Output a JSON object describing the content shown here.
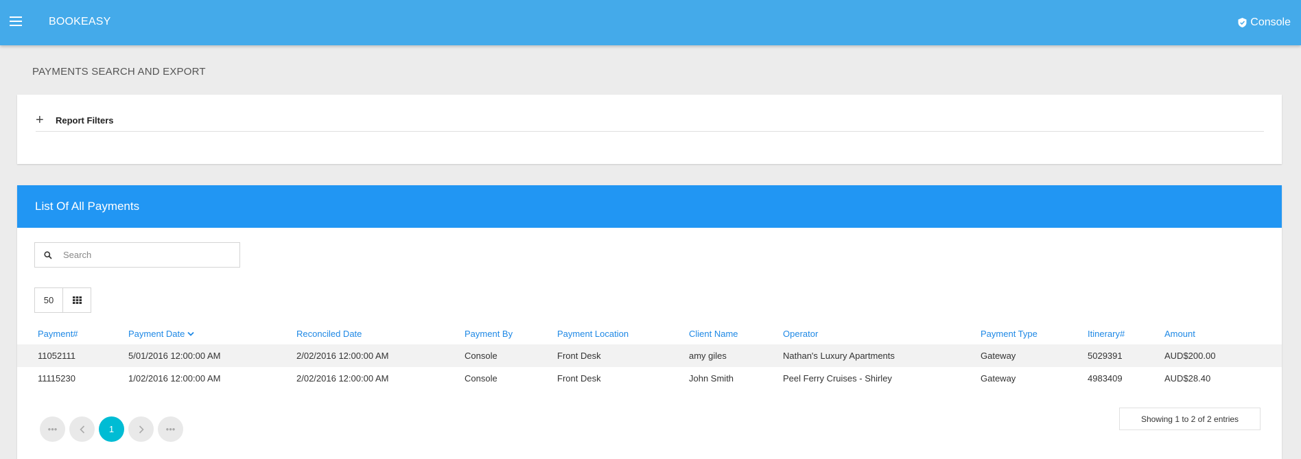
{
  "app": {
    "brand": "BOOKEASY",
    "console_label": "Console"
  },
  "page": {
    "title": "PAYMENTS SEARCH AND EXPORT"
  },
  "filters": {
    "label": "Report Filters"
  },
  "payments": {
    "header": "List Of All Payments",
    "search_placeholder": "Search",
    "page_size": "50",
    "columns": [
      "Payment#",
      "Payment Date",
      "Reconciled Date",
      "Payment By",
      "Payment Location",
      "Client Name",
      "Operator",
      "Payment Type",
      "Itinerary#",
      "Amount"
    ],
    "rows": [
      [
        "11052111",
        "5/01/2016 12:00:00 AM",
        "2/02/2016 12:00:00 AM",
        "Console",
        "Front Desk",
        "amy giles",
        "Nathan's Luxury Apartments",
        "Gateway",
        "5029391",
        "AUD$200.00"
      ],
      [
        "11115230",
        "1/02/2016 12:00:00 AM",
        "2/02/2016 12:00:00 AM",
        "Console",
        "Front Desk",
        "John Smith",
        "Peel Ferry Cruises - Shirley",
        "Gateway",
        "4983409",
        "AUD$28.40"
      ]
    ],
    "pagination": {
      "current_page": "1",
      "info": "Showing 1 to 2 of 2 entries"
    }
  },
  "colors": {
    "topbar": "#44aaea",
    "card_header": "#2196f3",
    "link": "#1e88e5",
    "active_page": "#00bcd4"
  }
}
